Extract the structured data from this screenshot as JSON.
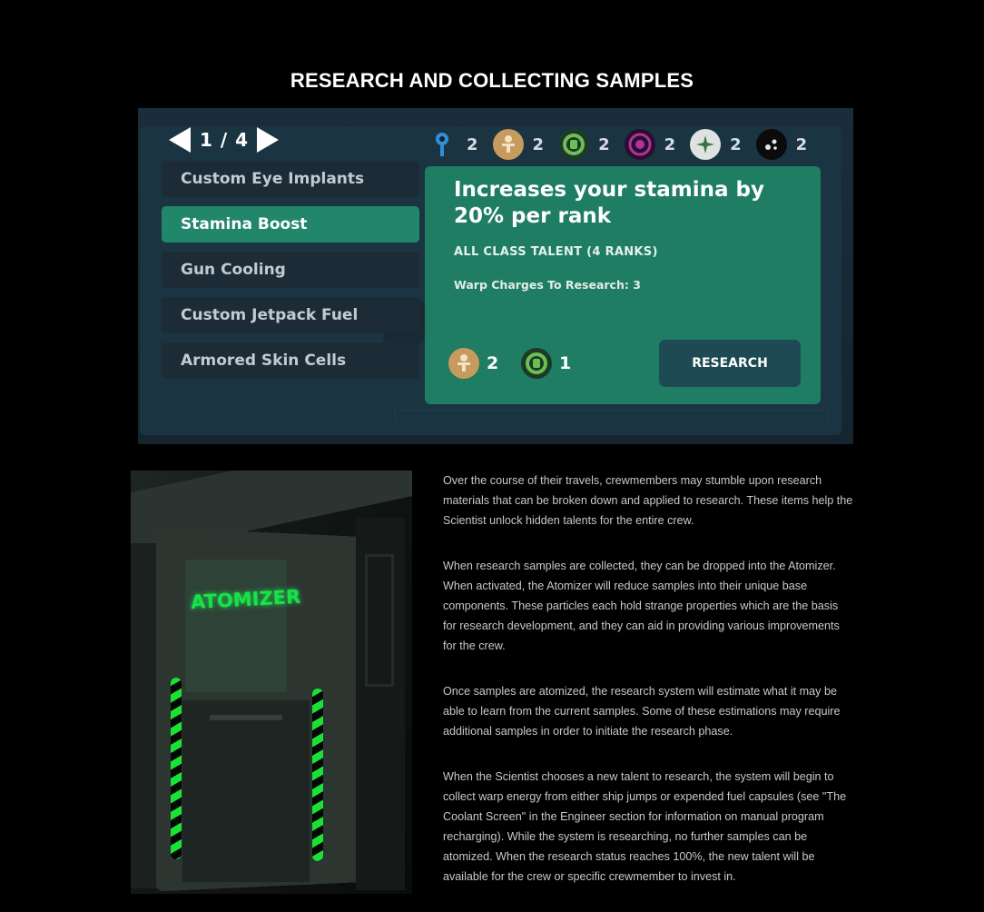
{
  "page": {
    "title": "RESEARCH AND COLLECTING SAMPLES"
  },
  "game_ui": {
    "pager": {
      "text": "1 / 4"
    },
    "resources": [
      {
        "icon": "blue-pin-icon",
        "count": "2",
        "color": "#2f8fd6"
      },
      {
        "icon": "tan-figure-icon",
        "count": "2",
        "color": "#c79a5e"
      },
      {
        "icon": "green-ring-icon",
        "count": "2",
        "color": "#4c8a4c"
      },
      {
        "icon": "purple-ring-icon",
        "count": "2",
        "color": "#8a2a8a"
      },
      {
        "icon": "white-star-icon",
        "count": "2",
        "color": "#d8ddd8"
      },
      {
        "icon": "black-dots-icon",
        "count": "2",
        "color": "#111111"
      }
    ],
    "talents": [
      {
        "label": "Custom Eye Implants"
      },
      {
        "label": "Stamina Boost",
        "selected": true
      },
      {
        "label": "Gun Cooling"
      },
      {
        "label": "Custom Jetpack Fuel"
      },
      {
        "label": "Armored Skin Cells"
      }
    ],
    "detail": {
      "title": "Increases your stamina by 20% per rank",
      "class_text": "ALL CLASS TALENT (4 RANKS)",
      "warp_text": "Warp Charges To Research: 3",
      "costs": [
        {
          "icon": "tan-figure-icon",
          "count": "2"
        },
        {
          "icon": "green-ring-icon",
          "count": "1"
        }
      ],
      "button_label": "RESEARCH"
    },
    "accent_color": "#22876a"
  },
  "atomizer_image": {
    "label": "ATOMIZER"
  },
  "article": {
    "paragraphs": [
      "Over the course of their travels, crewmembers may stumble upon research materials that can be broken down and applied to research. These items help the Scientist unlock hidden talents for the entire crew.",
      "When research samples are collected, they can be dropped into the Atomizer. When activated, the Atomizer will reduce samples into their unique base components. These particles each hold strange properties which are the basis for research development, and they can aid in providing various improvements for the crew.",
      "Once samples are atomized, the research system will estimate what it may be able to learn from the current samples. Some of these estimations may require additional samples in order to initiate the research phase.",
      "When the Scientist chooses a new talent to research, the system will begin to collect warp energy from either ship jumps or expended fuel capsules (see \"The Coolant Screen\" in the Engineer section for information on manual program recharging). While the system is researching, no further samples can be atomized. When the research status reaches 100%, the new talent will be available for the crew or specific crewmember to invest in."
    ]
  }
}
